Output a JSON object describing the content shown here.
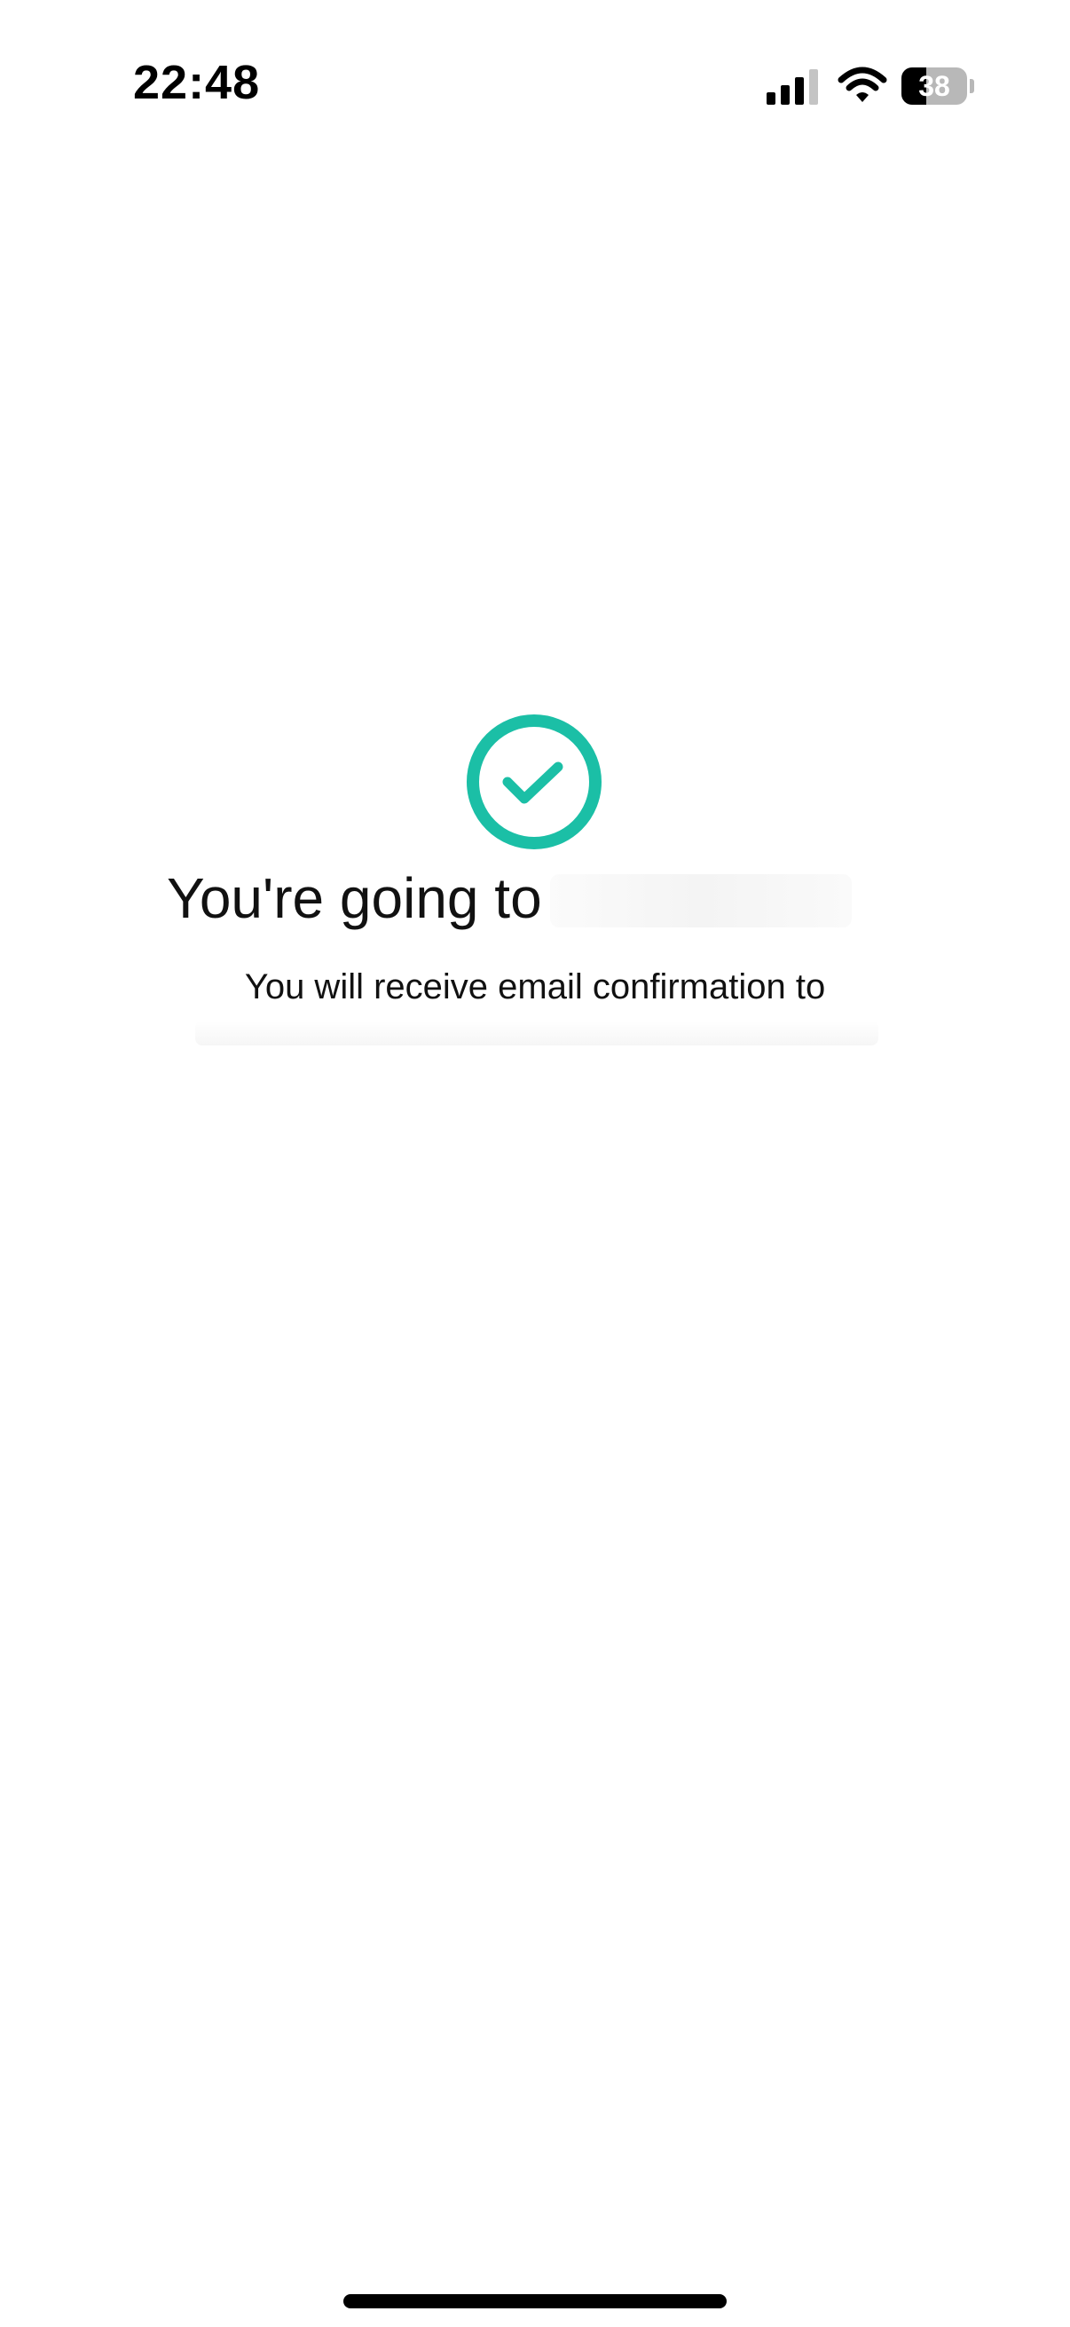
{
  "status_bar": {
    "time": "22:48",
    "battery_level": "38",
    "battery_fraction": 0.38,
    "icons": [
      "signal-icon",
      "wifi-icon",
      "battery-icon"
    ]
  },
  "confirmation": {
    "icon": "check-circle-icon",
    "accent_color": "#1bbfa6",
    "headline": "You're going to",
    "message": "You will receive email confirmation to"
  },
  "system": {
    "home_indicator": "home-indicator"
  }
}
